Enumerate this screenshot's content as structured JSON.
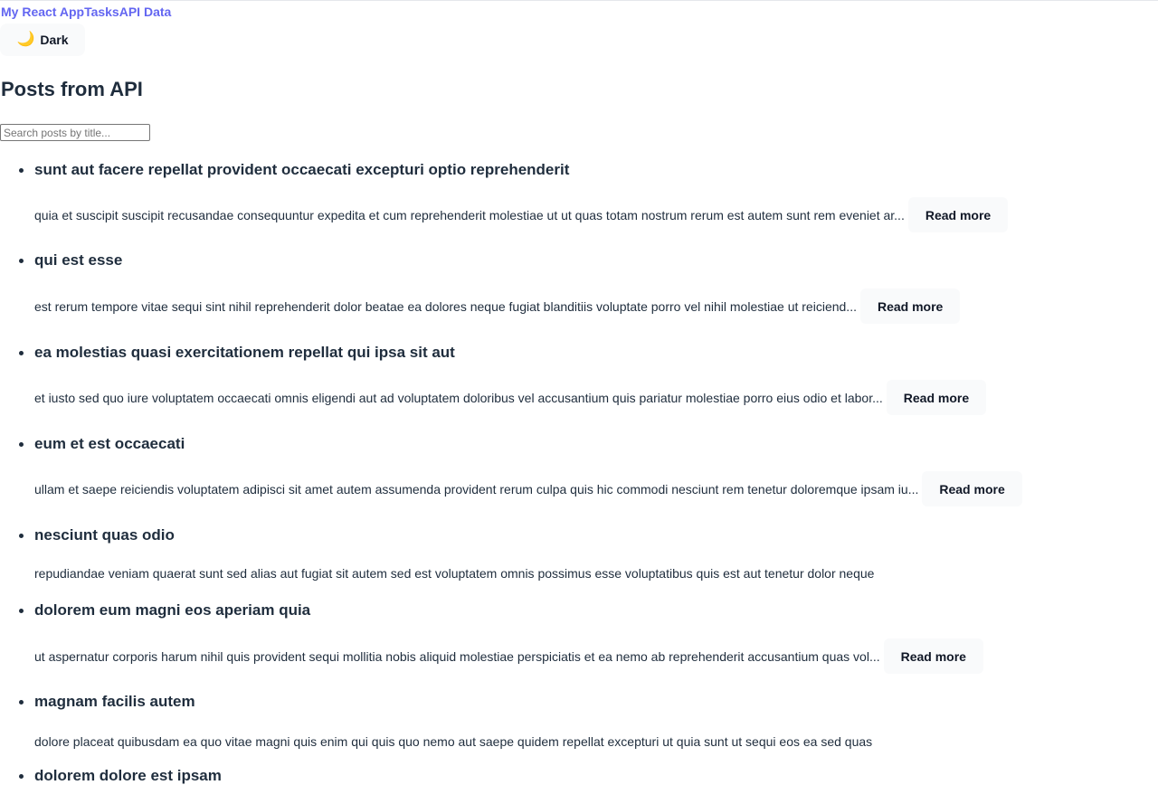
{
  "nav": {
    "brand": "My React App",
    "links": [
      "Tasks",
      "API Data"
    ]
  },
  "theme_toggle": {
    "icon": "🌙",
    "label": "Dark"
  },
  "page": {
    "title": "Posts from API"
  },
  "search": {
    "placeholder": "Search posts by title...",
    "value": ""
  },
  "posts": [
    {
      "title": "sunt aut facere repellat provident occaecati excepturi optio reprehenderit",
      "body": "quia et suscipit suscipit recusandae consequuntur expedita et cum reprehenderit molestiae ut ut quas totam nostrum rerum est autem sunt rem eveniet ar...",
      "read_more": "Read more"
    },
    {
      "title": "qui est esse",
      "body": "est rerum tempore vitae sequi sint nihil reprehenderit dolor beatae ea dolores neque fugiat blanditiis voluptate porro vel nihil molestiae ut reiciend...",
      "read_more": "Read more"
    },
    {
      "title": "ea molestias quasi exercitationem repellat qui ipsa sit aut",
      "body": "et iusto sed quo iure voluptatem occaecati omnis eligendi aut ad voluptatem doloribus vel accusantium quis pariatur molestiae porro eius odio et labor...",
      "read_more": "Read more"
    },
    {
      "title": "eum et est occaecati",
      "body": "ullam et saepe reiciendis voluptatem adipisci sit amet autem assumenda provident rerum culpa quis hic commodi nesciunt rem tenetur doloremque ipsam iu...",
      "read_more": "Read more"
    },
    {
      "title": "nesciunt quas odio",
      "body": "repudiandae veniam quaerat sunt sed alias aut fugiat sit autem sed est voluptatem omnis possimus esse voluptatibus quis est aut tenetur dolor neque",
      "read_more": ""
    },
    {
      "title": "dolorem eum magni eos aperiam quia",
      "body": "ut aspernatur corporis harum nihil quis provident sequi mollitia nobis aliquid molestiae perspiciatis et ea nemo ab reprehenderit accusantium quas vol...",
      "read_more": "Read more"
    },
    {
      "title": "magnam facilis autem",
      "body": "dolore placeat quibusdam ea quo vitae magni quis enim qui quis quo nemo aut saepe quidem repellat excepturi ut quia sunt ut sequi eos ea sed quas",
      "read_more": ""
    },
    {
      "title": "dolorem dolore est ipsam",
      "body": "",
      "read_more": ""
    }
  ],
  "colors": {
    "accent": "#6366f1",
    "text": "#1f2d3d",
    "button_bg": "#f9fafb"
  }
}
